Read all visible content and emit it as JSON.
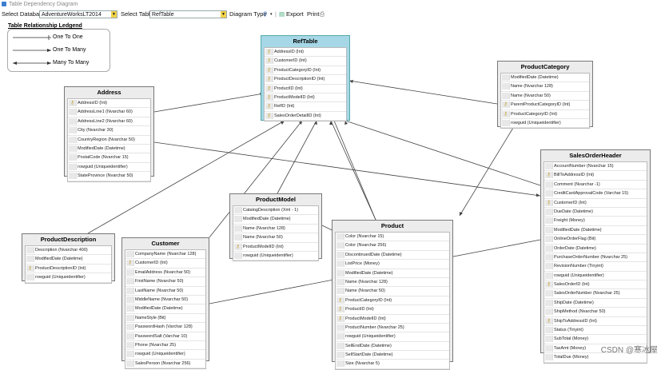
{
  "window": {
    "title": "Table Dependency Diagram"
  },
  "toolbar": {
    "select_db_label": "Select Database",
    "db_value": "AdventureWorksLT2014",
    "select_table_label": "Select Table",
    "table_value": "RefTable",
    "diagram_type_label": "Diagram Type",
    "export_label": "Export",
    "print_label": "Print"
  },
  "legend": {
    "title": "Table Relationship Ledgend",
    "items": [
      "One To One",
      "One To Many",
      "Many To Many"
    ]
  },
  "key_icon": "key-icon",
  "watermark": "CSDN @寒冰屋",
  "tables": {
    "reftable": {
      "name": "RefTable",
      "rows": [
        {
          "t": "AddressID (Int)",
          "k": true
        },
        {
          "t": "CustomerID (Int)",
          "k": true
        },
        {
          "t": "ProductCategoryID (Int)",
          "k": true
        },
        {
          "t": "ProductDescriptionID (Int)",
          "k": true
        },
        {
          "t": "ProductID (Int)",
          "k": true
        },
        {
          "t": "ProductModelID (Int)",
          "k": true
        },
        {
          "t": "RefID (Int)",
          "k": true
        },
        {
          "t": "SalesOrderDetailID (Int)",
          "k": true
        }
      ]
    },
    "productcategory": {
      "name": "ProductCategory",
      "rows": [
        {
          "t": "ModifiedDate (Datetime)",
          "k": false
        },
        {
          "t": "Name (Nvarchar 128)",
          "k": false
        },
        {
          "t": "Name (Nvarchar 50)",
          "k": false
        },
        {
          "t": "ParentProductCategoryID (Int)",
          "k": true
        },
        {
          "t": "ProductCategoryID (Int)",
          "k": true
        },
        {
          "t": "rowguid (Uniqueidentifier)",
          "k": false
        }
      ]
    },
    "address": {
      "name": "Address",
      "rows": [
        {
          "t": "AddressID (Int)",
          "k": true
        },
        {
          "t": "AddressLine1 (Nvarchar 60)",
          "k": false
        },
        {
          "t": "AddressLine2 (Nvarchar 60)",
          "k": false
        },
        {
          "t": "City (Nvarchar 30)",
          "k": false
        },
        {
          "t": "CountryRegion (Nvarchar 50)",
          "k": false
        },
        {
          "t": "ModifiedDate (Datetime)",
          "k": false
        },
        {
          "t": "PostalCode (Nvarchar 15)",
          "k": false
        },
        {
          "t": "rowguid (Uniqueidentifier)",
          "k": false
        },
        {
          "t": "StateProvince (Nvarchar 50)",
          "k": false
        }
      ]
    },
    "productmodel": {
      "name": "ProductModel",
      "rows": [
        {
          "t": "CatalogDescription (Xml - 1)",
          "k": false
        },
        {
          "t": "ModifiedDate (Datetime)",
          "k": false
        },
        {
          "t": "Name (Nvarchar 128)",
          "k": false
        },
        {
          "t": "Name (Nvarchar 50)",
          "k": false
        },
        {
          "t": "ProductModelID (Int)",
          "k": true
        },
        {
          "t": "rowguid (Uniqueidentifier)",
          "k": false
        }
      ]
    },
    "productdescription": {
      "name": "ProductDescription",
      "rows": [
        {
          "t": "Description (Nvarchar 400)",
          "k": false
        },
        {
          "t": "ModifiedDate (Datetime)",
          "k": false
        },
        {
          "t": "ProductDescriptionID (Int)",
          "k": true
        },
        {
          "t": "rowguid (Uniqueidentifier)",
          "k": false
        }
      ]
    },
    "customer": {
      "name": "Customer",
      "rows": [
        {
          "t": "CompanyName (Nvarchar 128)",
          "k": false
        },
        {
          "t": "CustomerID (Int)",
          "k": true
        },
        {
          "t": "EmailAddress (Nvarchar 50)",
          "k": false
        },
        {
          "t": "FirstName (Nvarchar 50)",
          "k": false
        },
        {
          "t": "LastName (Nvarchar 50)",
          "k": false
        },
        {
          "t": "MiddleName (Nvarchar 50)",
          "k": false
        },
        {
          "t": "ModifiedDate (Datetime)",
          "k": false
        },
        {
          "t": "NameStyle (Bit)",
          "k": false
        },
        {
          "t": "PasswordHash (Varchar 128)",
          "k": false
        },
        {
          "t": "PasswordSalt (Varchar 10)",
          "k": false
        },
        {
          "t": "Phone (Nvarchar 25)",
          "k": false
        },
        {
          "t": "rowguid (Uniqueidentifier)",
          "k": false
        },
        {
          "t": "SalesPerson (Nvarchar 256)",
          "k": false
        }
      ]
    },
    "product": {
      "name": "Product",
      "rows": [
        {
          "t": "Color (Nvarchar 15)",
          "k": false
        },
        {
          "t": "Color (Nvarchar 256)",
          "k": false
        },
        {
          "t": "DiscontinuedDate (Datetime)",
          "k": false
        },
        {
          "t": "ListPrice (Money)",
          "k": false
        },
        {
          "t": "ModifiedDate (Datetime)",
          "k": false
        },
        {
          "t": "Name (Nvarchar 128)",
          "k": false
        },
        {
          "t": "Name (Nvarchar 50)",
          "k": false
        },
        {
          "t": "ProductCategoryID (Int)",
          "k": true
        },
        {
          "t": "ProductID (Int)",
          "k": true
        },
        {
          "t": "ProductModelID (Int)",
          "k": true
        },
        {
          "t": "ProductNumber (Nvarchar 25)",
          "k": false
        },
        {
          "t": "rowguid (Uniqueidentifier)",
          "k": false
        },
        {
          "t": "SellEndDate (Datetime)",
          "k": false
        },
        {
          "t": "SellStartDate (Datetime)",
          "k": false
        },
        {
          "t": "Size (Nvarchar 5)",
          "k": false
        }
      ]
    },
    "salesorderheader": {
      "name": "SalesOrderHeader",
      "rows": [
        {
          "t": "AccountNumber (Nvarchar 15)",
          "k": false
        },
        {
          "t": "BillToAddressID (Int)",
          "k": true
        },
        {
          "t": "Comment (Nvarchar -1)",
          "k": false
        },
        {
          "t": "CreditCardApprovalCode (Varchar 15)",
          "k": false
        },
        {
          "t": "CustomerID (Int)",
          "k": true
        },
        {
          "t": "DueDate (Datetime)",
          "k": false
        },
        {
          "t": "Freight (Money)",
          "k": false
        },
        {
          "t": "ModifiedDate (Datetime)",
          "k": false
        },
        {
          "t": "OnlineOrderFlag (Bit)",
          "k": false
        },
        {
          "t": "OrderDate (Datetime)",
          "k": false
        },
        {
          "t": "PurchaseOrderNumber (Nvarchar 25)",
          "k": false
        },
        {
          "t": "RevisionNumber (Tinyint)",
          "k": false
        },
        {
          "t": "rowguid (Uniqueidentifier)",
          "k": false
        },
        {
          "t": "SalesOrderID (Int)",
          "k": true
        },
        {
          "t": "SalesOrderNumber (Nvarchar 25)",
          "k": false
        },
        {
          "t": "ShipDate (Datetime)",
          "k": false
        },
        {
          "t": "ShipMethod (Nvarchar 50)",
          "k": false
        },
        {
          "t": "ShipToAddressID (Int)",
          "k": true
        },
        {
          "t": "Status (Tinyint)",
          "k": false
        },
        {
          "t": "SubTotal (Money)",
          "k": false
        },
        {
          "t": "TaxAmt (Money)",
          "k": false
        },
        {
          "t": "TotalDue (Money)",
          "k": false
        }
      ]
    }
  }
}
